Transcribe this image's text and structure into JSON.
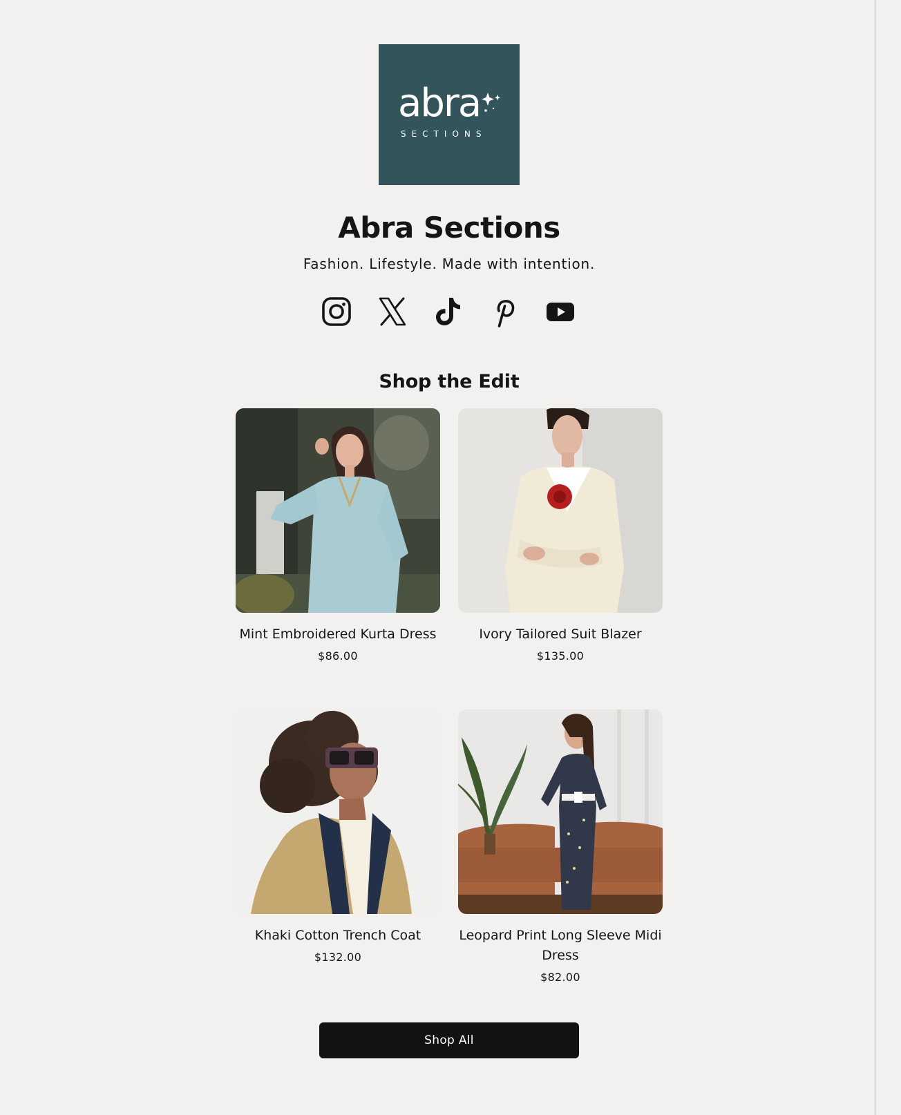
{
  "brand": {
    "logo_word": "abra",
    "logo_sub": "SECTIONS",
    "logo_bg": "#32545a",
    "name": "Abra Sections",
    "tagline": "Fashion. Lifestyle. Made with intention."
  },
  "socials": [
    {
      "name": "Instagram",
      "icon": "instagram-icon"
    },
    {
      "name": "X",
      "icon": "x-icon"
    },
    {
      "name": "TikTok",
      "icon": "tiktok-icon"
    },
    {
      "name": "Pinterest",
      "icon": "pinterest-icon"
    },
    {
      "name": "YouTube",
      "icon": "youtube-icon"
    }
  ],
  "section": {
    "title": "Shop the Edit"
  },
  "products": [
    {
      "name": "Mint Embroidered Kurta Dress",
      "price": "$86.00"
    },
    {
      "name": "Ivory Tailored Suit Blazer",
      "price": "$135.00"
    },
    {
      "name": "Khaki Cotton Trench Coat",
      "price": "$132.00"
    },
    {
      "name": "Leopard Print Long Sleeve Midi Dress",
      "price": "$82.00"
    }
  ],
  "cta": {
    "label": "Shop All"
  },
  "colors": {
    "background": "#f2f1f0",
    "text": "#151515",
    "button": "#121212"
  }
}
